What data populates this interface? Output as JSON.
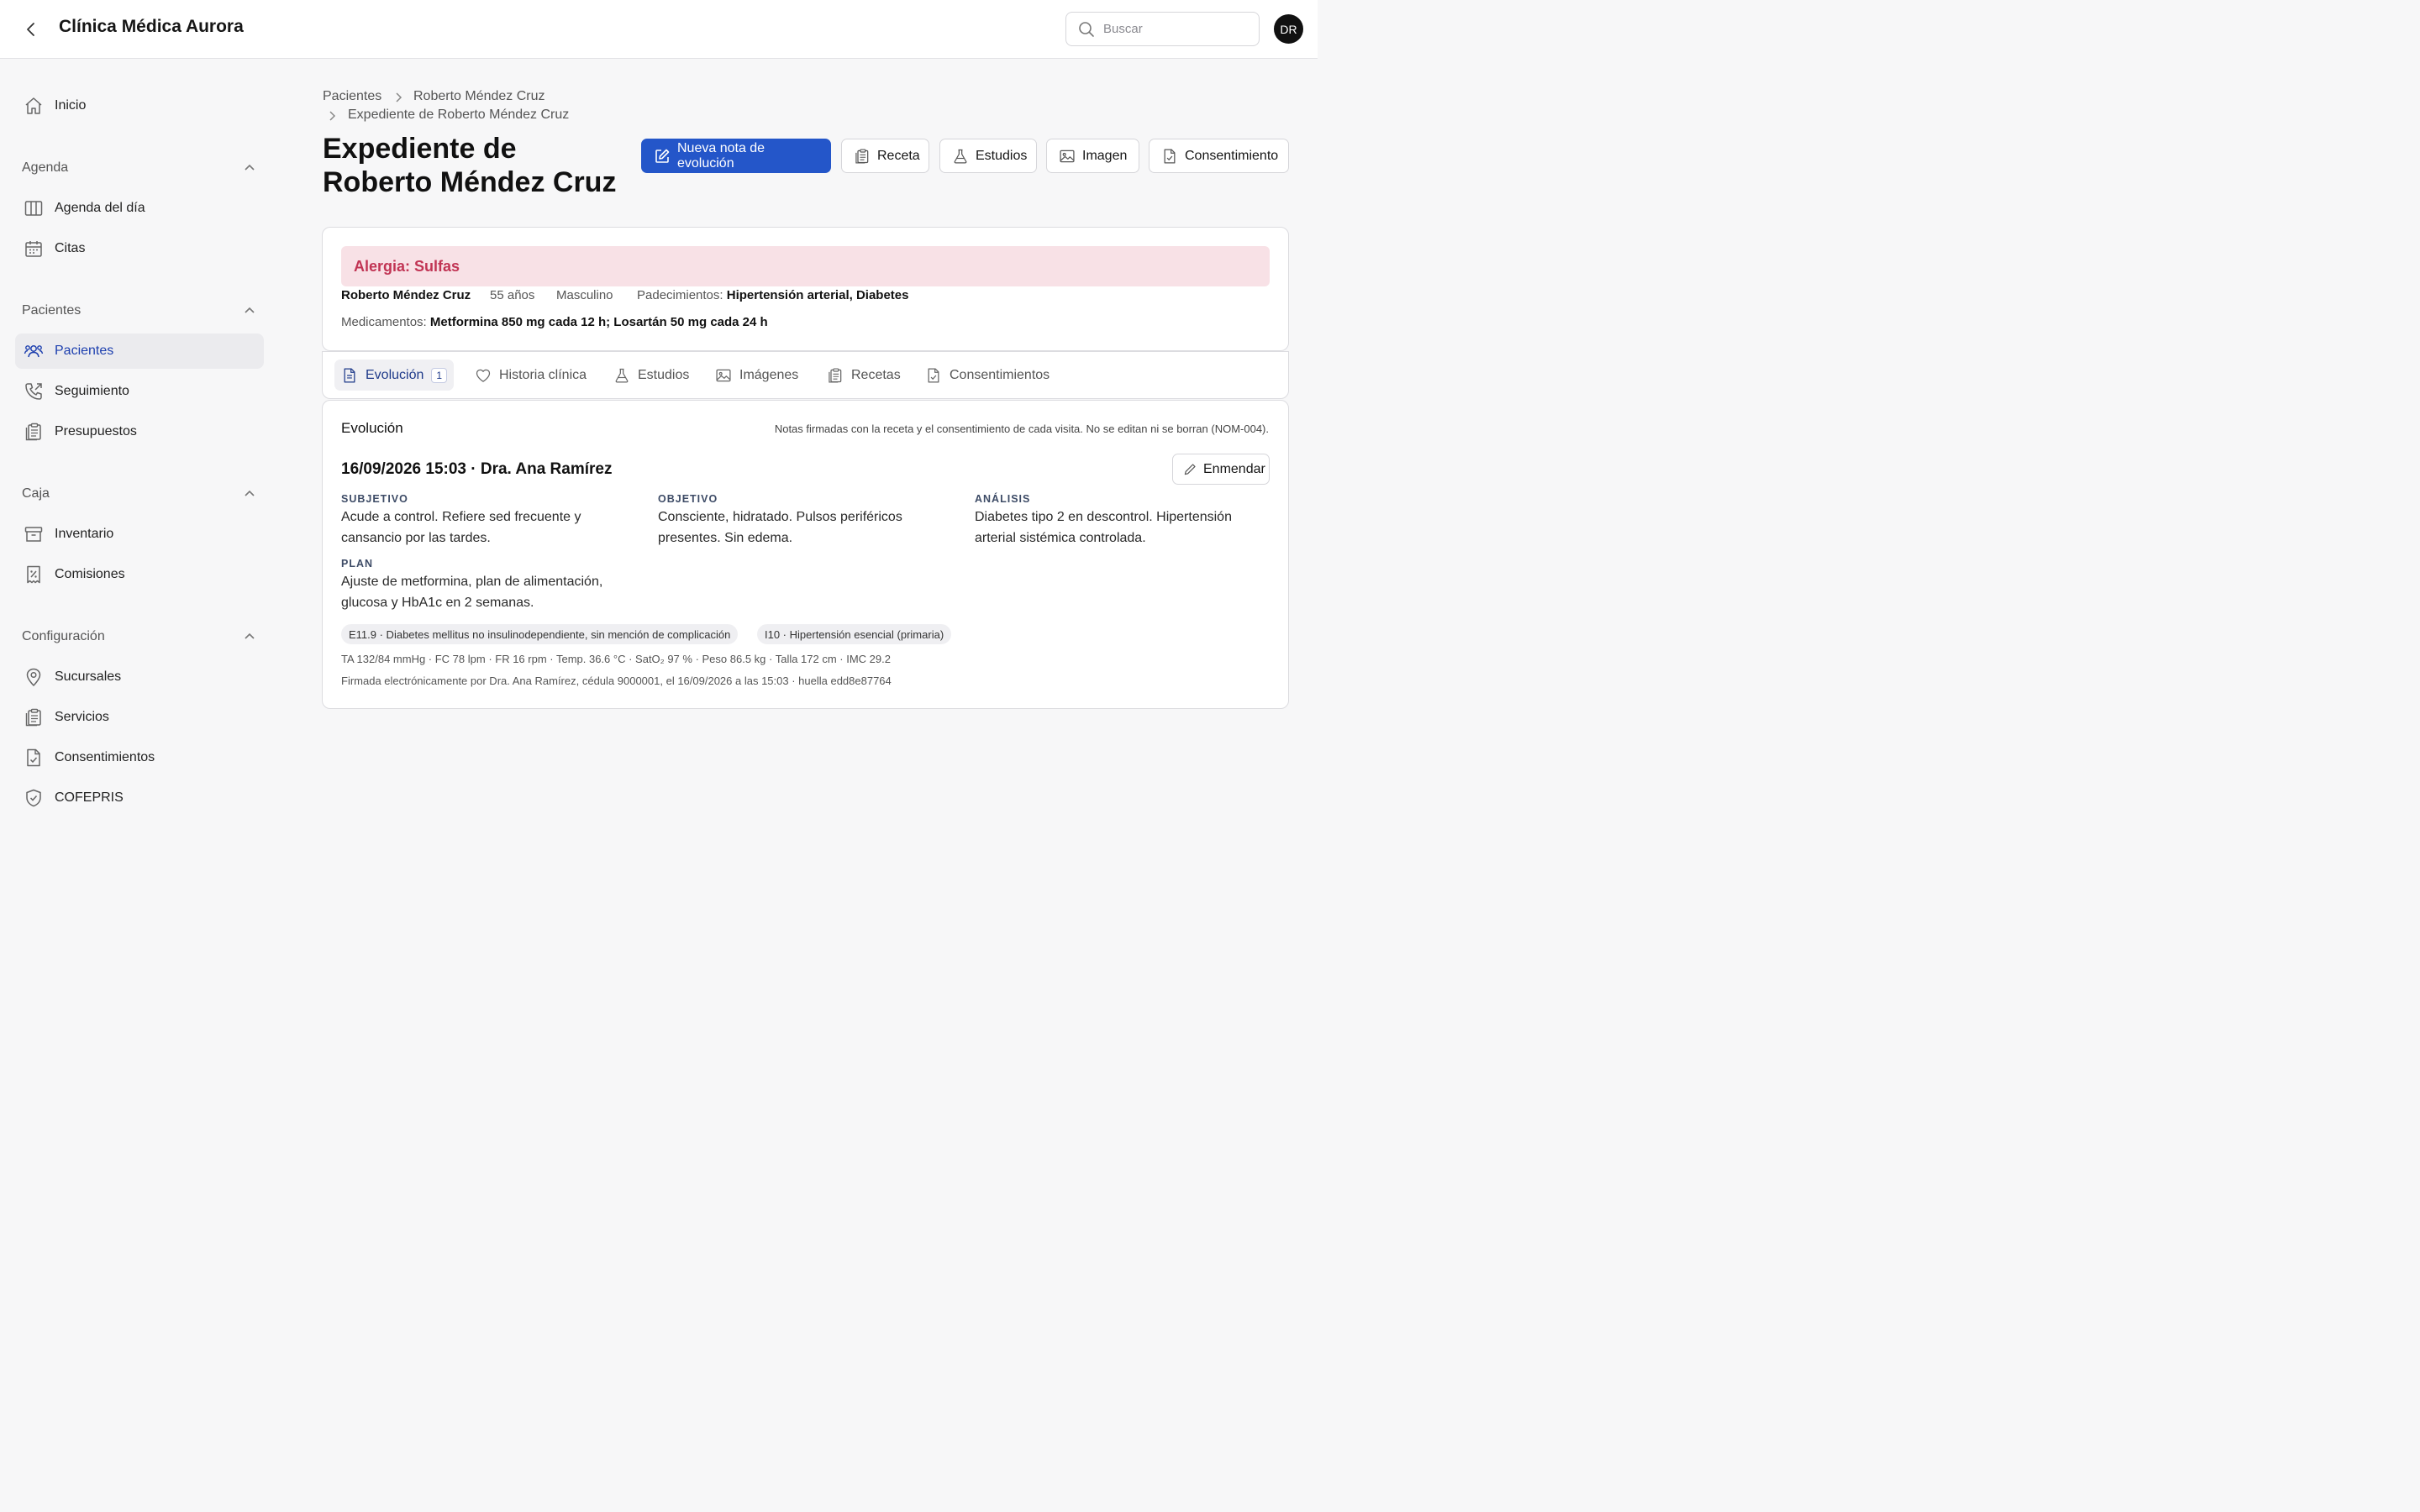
{
  "header": {
    "title": "Clínica Médica Aurora",
    "search_placeholder": "Buscar",
    "avatar_initials": "DR"
  },
  "sidebar": {
    "home": "Inicio",
    "sections": [
      {
        "label": "Agenda",
        "items": [
          "Agenda del día",
          "Citas"
        ]
      },
      {
        "label": "Pacientes",
        "items": [
          "Pacientes",
          "Seguimiento",
          "Presupuestos"
        ]
      },
      {
        "label": "Caja",
        "items": [
          "Inventario",
          "Comisiones"
        ]
      },
      {
        "label": "Configuración",
        "items": [
          "Sucursales",
          "Servicios",
          "Consentimientos",
          "COFEPRIS"
        ]
      }
    ]
  },
  "breadcrumb": [
    "Pacientes",
    "Roberto Méndez Cruz",
    "Expediente de Roberto Méndez Cruz"
  ],
  "page_title": "Expediente de Roberto Méndez Cruz",
  "actions": {
    "new_note": "Nueva nota de evolución",
    "prescription": "Receta",
    "studies": "Estudios",
    "image": "Imagen",
    "consent": "Consentimiento"
  },
  "patient": {
    "allergy": "Alergia: Sulfas",
    "name": "Roberto Méndez Cruz",
    "age": "55 años",
    "sex": "Masculino",
    "conditions_label": "Padecimientos:",
    "conditions": "Hipertensión arterial, Diabetes",
    "meds_label": "Medicamentos:",
    "meds": "Metformina 850 mg cada 12 h; Losartán 50 mg cada 24 h"
  },
  "tabs": [
    {
      "label": "Evolución",
      "badge": "1"
    },
    {
      "label": "Historia clínica"
    },
    {
      "label": "Estudios"
    },
    {
      "label": "Imágenes"
    },
    {
      "label": "Recetas"
    },
    {
      "label": "Consentimientos"
    }
  ],
  "evolution": {
    "title": "Evolución",
    "notice": "Notas firmadas con la receta y el consentimiento de cada visita. No se editan ni se borran (NOM-004).",
    "note_header": "16/09/2026 15:03 · Dra. Ana Ramírez",
    "amend": "Enmendar",
    "subjective_label": "SUBJETIVO",
    "subjective": "Acude a control. Refiere sed frecuente y cansancio por las tardes.",
    "objective_label": "OBJETIVO",
    "objective": "Consciente, hidratado. Pulsos periféricos presentes. Sin edema.",
    "analysis_label": "ANÁLISIS",
    "analysis": "Diabetes tipo 2 en descontrol. Hipertensión arterial sistémica controlada.",
    "plan_label": "PLAN",
    "plan": "Ajuste de metformina, plan de alimentación, glucosa y HbA1c en 2 semanas.",
    "diagnoses": [
      "E11.9 · Diabetes mellitus no insulinodependiente, sin mención de complicación",
      "I10 · Hipertensión esencial (primaria)"
    ],
    "vitals": "TA 132/84 mmHg · FC 78 lpm · FR 16 rpm · Temp. 36.6 °C · SatO₂ 97 % · Peso 86.5 kg · Talla 172 cm · IMC 29.2",
    "signature": "Firmada electrónicamente por Dra. Ana Ramírez, cédula 9000001, el 16/09/2026 a las 15:03 · huella edd8e87764"
  }
}
